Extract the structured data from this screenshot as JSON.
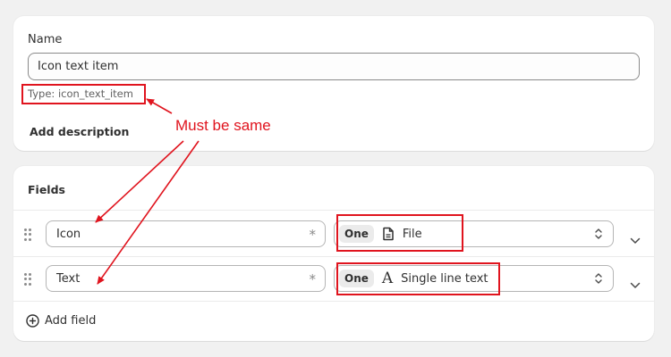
{
  "name_card": {
    "label": "Name",
    "name_value": "Icon text item",
    "type_hint": "Type: icon_text_item",
    "add_description": "Add description"
  },
  "fields_card": {
    "heading": "Fields",
    "rows": [
      {
        "name": "Icon",
        "required_mark": "*",
        "cardinality": "One",
        "type_icon": "file-icon",
        "type_label": "File"
      },
      {
        "name": "Text",
        "required_mark": "*",
        "cardinality": "One",
        "type_icon": "text-a-icon",
        "type_label": "Single line text"
      }
    ],
    "add_field": "Add field"
  },
  "annotation": {
    "text": "Must be same",
    "color": "#e0141e"
  }
}
